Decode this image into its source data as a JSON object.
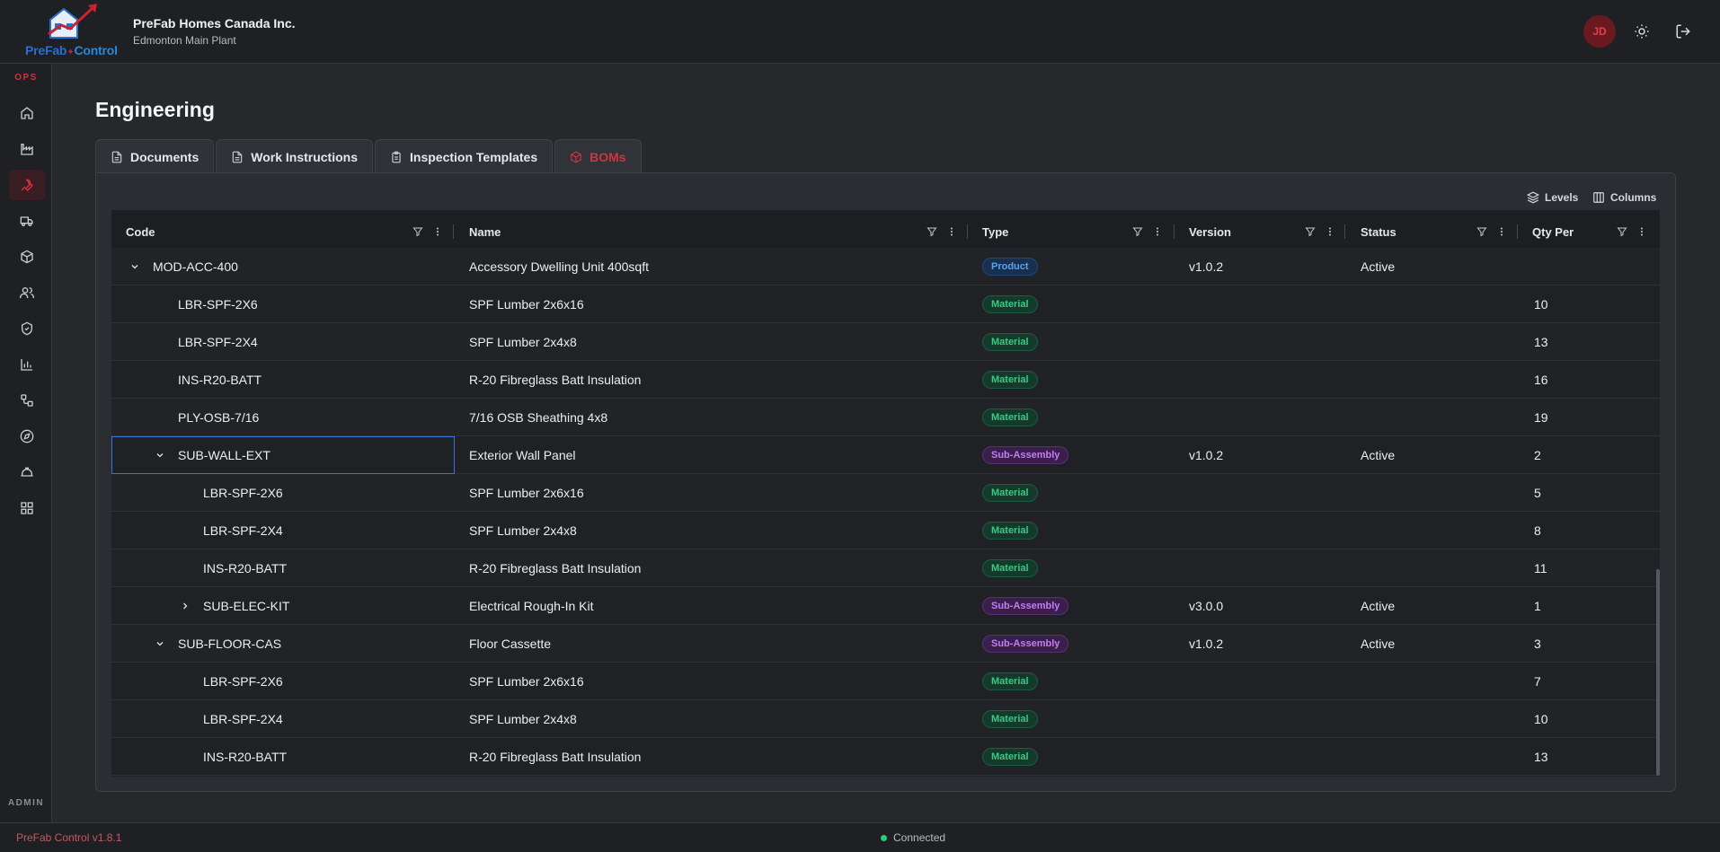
{
  "header": {
    "logo_text_a": "PreFab",
    "logo_text_b": "✦",
    "logo_text_c": "Control",
    "company": "PreFab Homes Canada Inc.",
    "plant": "Edmonton Main Plant",
    "avatar_initials": "JD"
  },
  "sidebar": {
    "ops_label": "OPS",
    "admin_label": "ADMIN",
    "items": [
      "home-icon",
      "factory-icon",
      "wrench-icon",
      "truck-icon",
      "box-icon",
      "users-icon",
      "shield-check-icon",
      "bar-chart-icon",
      "workflow-icon",
      "compass-icon",
      "hard-hat-icon",
      "grid-icon"
    ],
    "active_item": "wrench-icon"
  },
  "page": {
    "title": "Engineering"
  },
  "tabs": [
    {
      "label": "Documents",
      "icon": "document-icon"
    },
    {
      "label": "Work Instructions",
      "icon": "document-icon"
    },
    {
      "label": "Inspection Templates",
      "icon": "clipboard-icon"
    },
    {
      "label": "BOMs",
      "icon": "cube-icon",
      "active": true
    }
  ],
  "toolbar": {
    "levels_label": "Levels",
    "columns_label": "Columns"
  },
  "grid": {
    "columns": [
      "Code",
      "Name",
      "Type",
      "Version",
      "Status",
      "Qty Per"
    ],
    "rows": [
      {
        "code": "MOD-ACC-400",
        "name": "Accessory Dwelling Unit 400sqft",
        "type": "Product",
        "version": "v1.0.2",
        "status": "Active",
        "qty": "",
        "level": 0,
        "expander": "expanded"
      },
      {
        "code": "LBR-SPF-2X6",
        "name": "SPF Lumber 2x6x16",
        "type": "Material",
        "version": "",
        "status": "",
        "qty": "10",
        "level": 1,
        "expander": "none"
      },
      {
        "code": "LBR-SPF-2X4",
        "name": "SPF Lumber 2x4x8",
        "type": "Material",
        "version": "",
        "status": "",
        "qty": "13",
        "level": 1,
        "expander": "none"
      },
      {
        "code": "INS-R20-BATT",
        "name": "R-20 Fibreglass Batt Insulation",
        "type": "Material",
        "version": "",
        "status": "",
        "qty": "16",
        "level": 1,
        "expander": "none"
      },
      {
        "code": "PLY-OSB-7/16",
        "name": "7/16 OSB Sheathing 4x8",
        "type": "Material",
        "version": "",
        "status": "",
        "qty": "19",
        "level": 1,
        "expander": "none"
      },
      {
        "code": "SUB-WALL-EXT",
        "name": "Exterior Wall Panel",
        "type": "Sub-Assembly",
        "version": "v1.0.2",
        "status": "Active",
        "qty": "2",
        "level": 1,
        "expander": "expanded",
        "selected": true
      },
      {
        "code": "LBR-SPF-2X6",
        "name": "SPF Lumber 2x6x16",
        "type": "Material",
        "version": "",
        "status": "",
        "qty": "5",
        "level": 2,
        "expander": "none"
      },
      {
        "code": "LBR-SPF-2X4",
        "name": "SPF Lumber 2x4x8",
        "type": "Material",
        "version": "",
        "status": "",
        "qty": "8",
        "level": 2,
        "expander": "none"
      },
      {
        "code": "INS-R20-BATT",
        "name": "R-20 Fibreglass Batt Insulation",
        "type": "Material",
        "version": "",
        "status": "",
        "qty": "11",
        "level": 2,
        "expander": "none"
      },
      {
        "code": "SUB-ELEC-KIT",
        "name": "Electrical Rough-In Kit",
        "type": "Sub-Assembly",
        "version": "v3.0.0",
        "status": "Active",
        "qty": "1",
        "level": 2,
        "expander": "collapsed"
      },
      {
        "code": "SUB-FLOOR-CAS",
        "name": "Floor Cassette",
        "type": "Sub-Assembly",
        "version": "v1.0.2",
        "status": "Active",
        "qty": "3",
        "level": 1,
        "expander": "expanded"
      },
      {
        "code": "LBR-SPF-2X6",
        "name": "SPF Lumber 2x6x16",
        "type": "Material",
        "version": "",
        "status": "",
        "qty": "7",
        "level": 2,
        "expander": "none"
      },
      {
        "code": "LBR-SPF-2X4",
        "name": "SPF Lumber 2x4x8",
        "type": "Material",
        "version": "",
        "status": "",
        "qty": "10",
        "level": 2,
        "expander": "none"
      },
      {
        "code": "INS-R20-BATT",
        "name": "R-20 Fibreglass Batt Insulation",
        "type": "Material",
        "version": "",
        "status": "",
        "qty": "13",
        "level": 2,
        "expander": "none"
      }
    ]
  },
  "footer": {
    "version": "PreFab Control v1.8.1",
    "status": "Connected"
  },
  "colors": {
    "accent": "#d0343f",
    "material": "#38c985",
    "product": "#5aa2f0",
    "subassembly": "#c27df0",
    "connected": "#2ecc71"
  }
}
